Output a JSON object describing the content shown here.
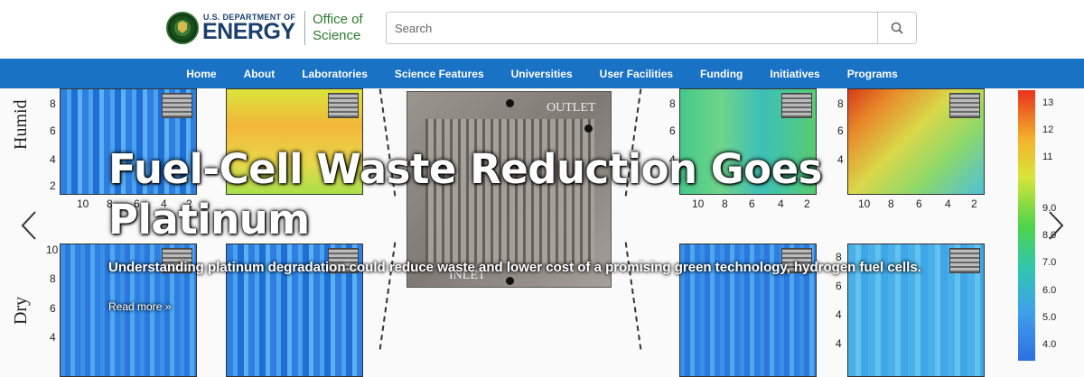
{
  "header": {
    "logo_small": "U.S. DEPARTMENT OF",
    "logo_big": "ENERGY",
    "office_line1": "Office of",
    "office_line2": "Science"
  },
  "search": {
    "placeholder": "Search",
    "icon": "search-icon"
  },
  "nav": {
    "items": [
      "Home",
      "About",
      "Laboratories",
      "Science Features",
      "Universities",
      "User Facilities",
      "Funding",
      "Initiatives",
      "Programs"
    ]
  },
  "hero": {
    "headline": "Fuel-Cell Waste Reduction Goes Platinum",
    "subhead": "Understanding platinum degradation could reduce waste and lower cost of a promising green technology, hydrogen fuel cells.",
    "read_more": "Read more »",
    "prev_icon": "chevron-left-icon",
    "next_icon": "chevron-right-icon",
    "figure": {
      "row_labels": [
        "Humid",
        "Dry"
      ],
      "plate_outlet": "OUTLET",
      "plate_inlet": "INLET",
      "y_ticks_top": [
        "8",
        "6",
        "4",
        "2"
      ],
      "x_ticks": [
        "10",
        "8",
        "6",
        "4",
        "2"
      ],
      "y_ticks_bottom": [
        "10",
        "8",
        "6",
        "4"
      ],
      "colorbar_ticks": [
        "13",
        "12",
        "11",
        "9.0",
        "8.0",
        "7.0",
        "6.0",
        "5.0",
        "4.0"
      ]
    }
  },
  "colors": {
    "nav_bg": "#1a72c4",
    "logo_text": "#1c3f6e",
    "office_text": "#2d7a2d"
  }
}
